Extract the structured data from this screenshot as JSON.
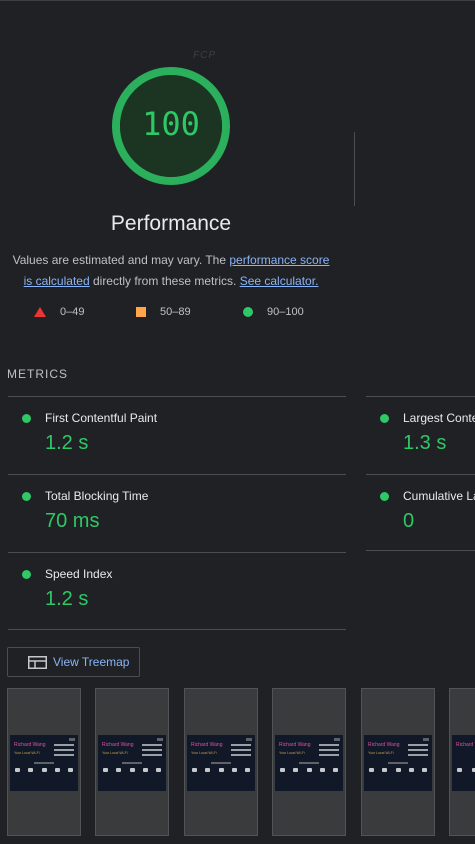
{
  "fcp_ghost": "FCP",
  "score": "100",
  "category_title": "Performance",
  "description": {
    "part1": "Values are estimated and may vary. The ",
    "link1": "performance score is calculated",
    "part2": " directly from these metrics. ",
    "link2": "See calculator."
  },
  "legend": [
    {
      "label": "0–49",
      "icon": "triangle-icon",
      "color": "#eb3434"
    },
    {
      "label": "50–89",
      "icon": "square-icon",
      "color": "#ffa64d"
    },
    {
      "label": "90–100",
      "icon": "circle-icon",
      "color": "#2ec866"
    }
  ],
  "metrics_heading": "METRICS",
  "metrics": [
    {
      "label": "First Contentful Paint",
      "value": "1.2 s"
    },
    {
      "label": "Largest Conte",
      "value": "1.3 s"
    },
    {
      "label": "Total Blocking Time",
      "value": "70 ms"
    },
    {
      "label": "Cumulative La",
      "value": "0"
    },
    {
      "label": "Speed Index",
      "value": "1.2 s"
    }
  ],
  "treemap_button": "View Treemap",
  "thumbnail": {
    "name": "Richard Wang",
    "subtitle": "Your Local Wi-Fi"
  },
  "colors": {
    "pass": "#2ec866",
    "average": "#ffa64d",
    "fail": "#eb3434",
    "link": "#8ab4f8",
    "background": "#202124"
  }
}
